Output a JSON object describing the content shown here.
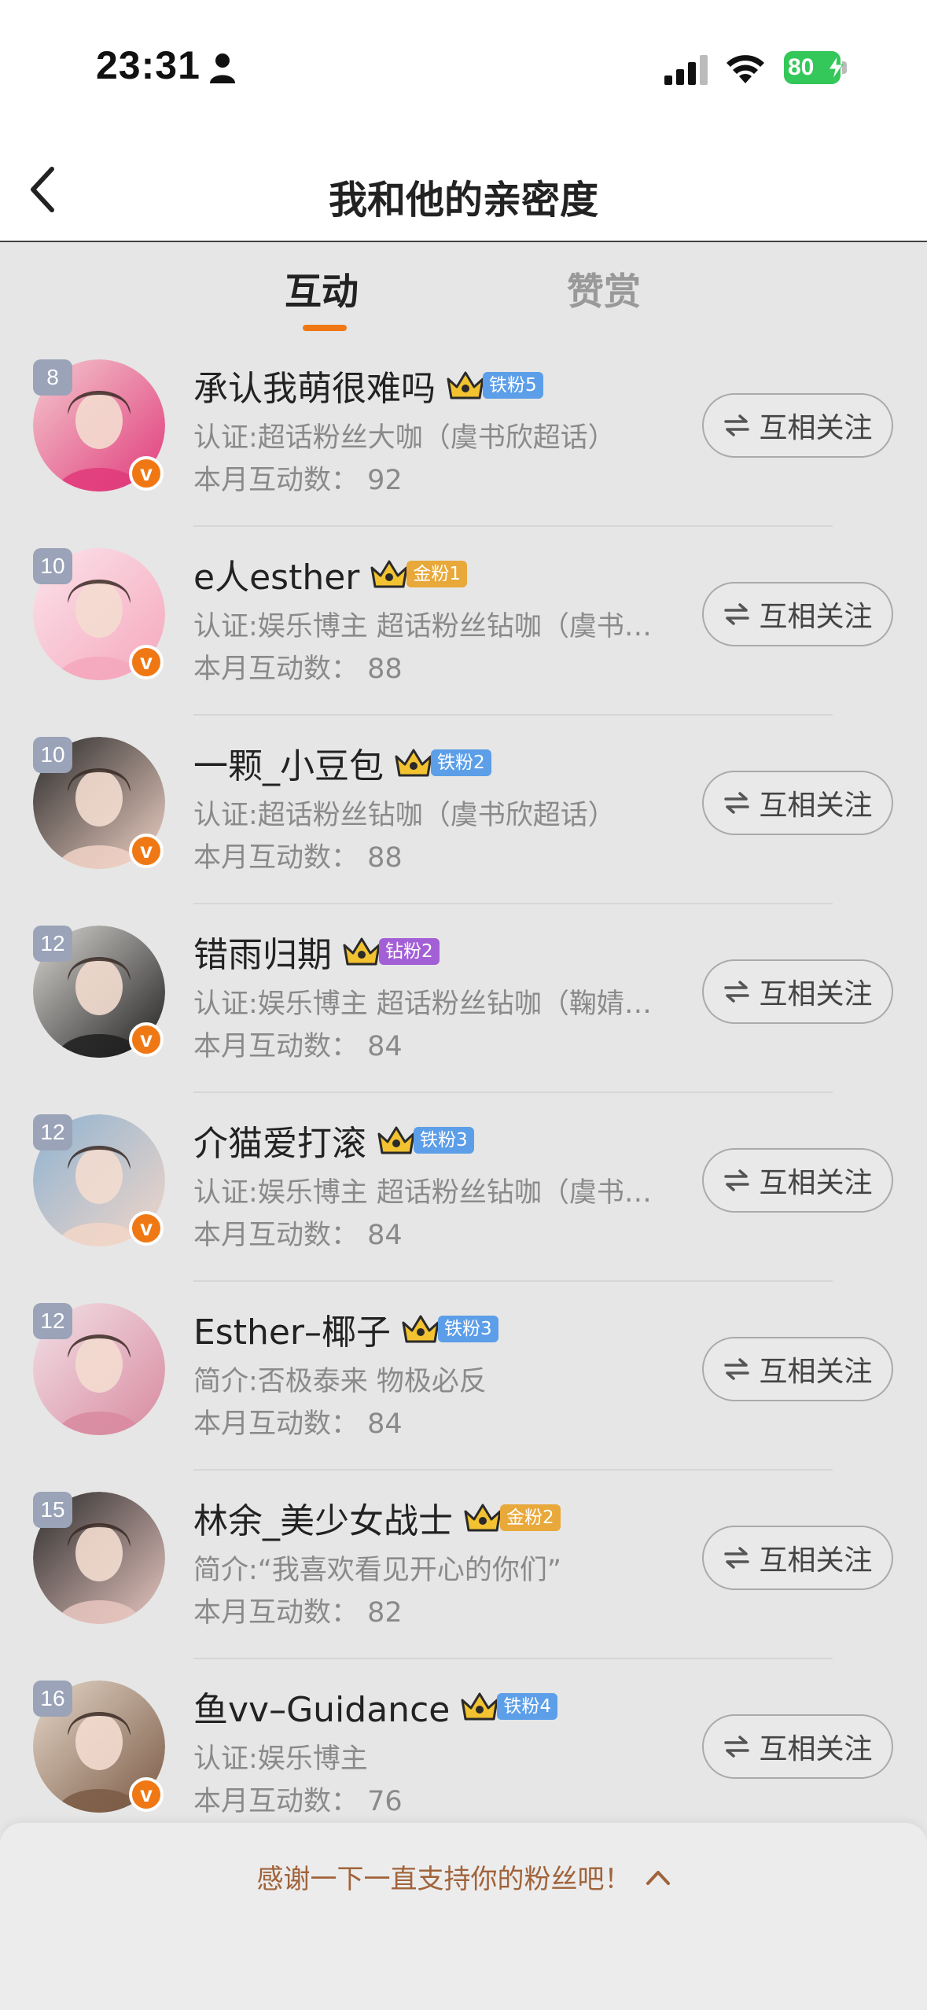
{
  "status_bar": {
    "time": "23:31",
    "battery": "80"
  },
  "nav": {
    "title": "我和他的亲密度"
  },
  "tabs": [
    {
      "label": "互动",
      "active": true
    },
    {
      "label": "赞赏",
      "active": false
    }
  ],
  "colors": {
    "accent": "#f07814",
    "verified": "#f07814",
    "fan_iron": "#5c9ee8",
    "fan_gold": "#e8a83a",
    "fan_diamond": "#a35fd6"
  },
  "users": [
    {
      "rank": "8",
      "name": "承认我萌很难吗",
      "badge": "铁粉5",
      "badge_type": "iron",
      "desc": "认证:超话粉丝大咖（虞书欣超话）",
      "count": "本月互动数：  92",
      "verified": true,
      "follow": "互相关注",
      "avatar_colors": [
        "#f4c9cf",
        "#e03a7a"
      ]
    },
    {
      "rank": "10",
      "name": "e人esther",
      "badge": "金粉1",
      "badge_type": "gold",
      "desc": "认证:娱乐博主 超话粉丝钻咖（虞书…",
      "count": "本月互动数：  88",
      "verified": true,
      "follow": "互相关注",
      "avatar_colors": [
        "#fbe3ea",
        "#f5a7bd"
      ]
    },
    {
      "rank": "10",
      "name": "一颗_小豆包",
      "badge": "铁粉2",
      "badge_type": "iron",
      "desc": "认证:超话粉丝钻咖（虞书欣超话）",
      "count": "本月互动数：  88",
      "verified": true,
      "follow": "互相关注",
      "avatar_colors": [
        "#2a2a2a",
        "#f1d2c6"
      ]
    },
    {
      "rank": "12",
      "name": "错雨归期",
      "badge": "钻粉2",
      "badge_type": "diamond",
      "desc": "认证:娱乐博主 超话粉丝钻咖（鞠婧…",
      "count": "本月互动数：  84",
      "verified": true,
      "follow": "互相关注",
      "avatar_colors": [
        "#d9d6d2",
        "#1e1e1e"
      ]
    },
    {
      "rank": "12",
      "name": "介猫爱打滚",
      "badge": "铁粉3",
      "badge_type": "iron",
      "desc": "认证:娱乐博主 超话粉丝钻咖（虞书…",
      "count": "本月互动数：  84",
      "verified": true,
      "follow": "互相关注",
      "avatar_colors": [
        "#8fb3d1",
        "#f2d6c8"
      ]
    },
    {
      "rank": "12",
      "name": "Esther–椰子",
      "badge": "铁粉3",
      "badge_type": "iron",
      "desc": "简介:否极泰来 物极必反",
      "count": "本月互动数：  84",
      "verified": false,
      "follow": "互相关注",
      "avatar_colors": [
        "#f2e0e6",
        "#d88aa0"
      ]
    },
    {
      "rank": "15",
      "name": "林余_美少女战士",
      "badge": "金粉2",
      "badge_type": "gold",
      "desc": "简介:“我喜欢看见开心的你们”",
      "count": "本月互动数：  82",
      "verified": false,
      "follow": "互相关注",
      "avatar_colors": [
        "#2c2c2c",
        "#e8c6c0"
      ]
    },
    {
      "rank": "16",
      "name": "鱼vv–Guidance",
      "badge": "铁粉4",
      "badge_type": "iron",
      "desc": "认证:娱乐博主",
      "count": "本月互动数：  76",
      "verified": true,
      "follow": "互相关注",
      "avatar_colors": [
        "#e5d6c8",
        "#7a5a45"
      ]
    }
  ],
  "bottom": {
    "text": "感谢一下一直支持你的粉丝吧！"
  }
}
